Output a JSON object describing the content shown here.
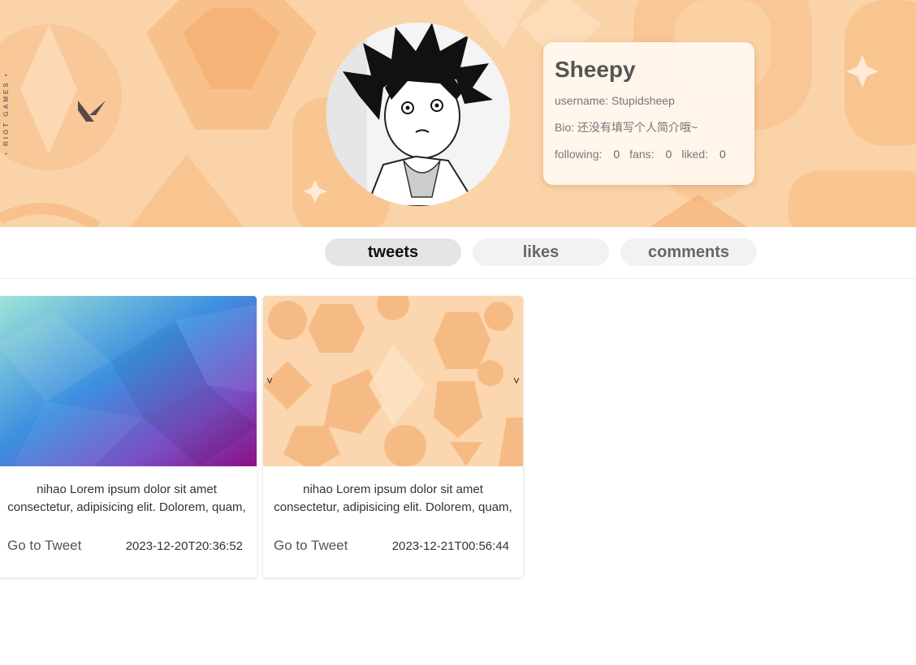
{
  "banner": {
    "riot_text": "• RIOT GAMES •",
    "colors": {
      "base": "#fbd3a8",
      "shape": "#f6b678",
      "shape_light": "#fde3c6"
    }
  },
  "profile": {
    "name": "Sheepy",
    "username_line": "username: Stupidsheep",
    "bio_line": "Bio: 还没有填写个人简介哦~",
    "stats": {
      "following_label": "following:",
      "following": "0",
      "fans_label": "fans:",
      "fans": "0",
      "liked_label": "liked:",
      "liked": "0"
    }
  },
  "tabs": [
    {
      "label": "tweets",
      "active": true
    },
    {
      "label": "likes",
      "active": false
    },
    {
      "label": "comments",
      "active": false
    }
  ],
  "tweets": [
    {
      "text": "nihao Lorem ipsum dolor sit amet consectetur, adipisicing elit. Dolorem, quam, p...",
      "link_label": "Go to Tweet",
      "date": "2023-12-20T20:36:52",
      "image": "gradient-lowpoly"
    },
    {
      "text": "nihao Lorem ipsum dolor sit amet consectetur, adipisicing elit. Dolorem, quam, p...",
      "link_label": "Go to Tweet",
      "date": "2023-12-21T00:56:44",
      "image": "orange-pattern",
      "prev_arrow": "˅",
      "next_arrow": "˅"
    }
  ]
}
